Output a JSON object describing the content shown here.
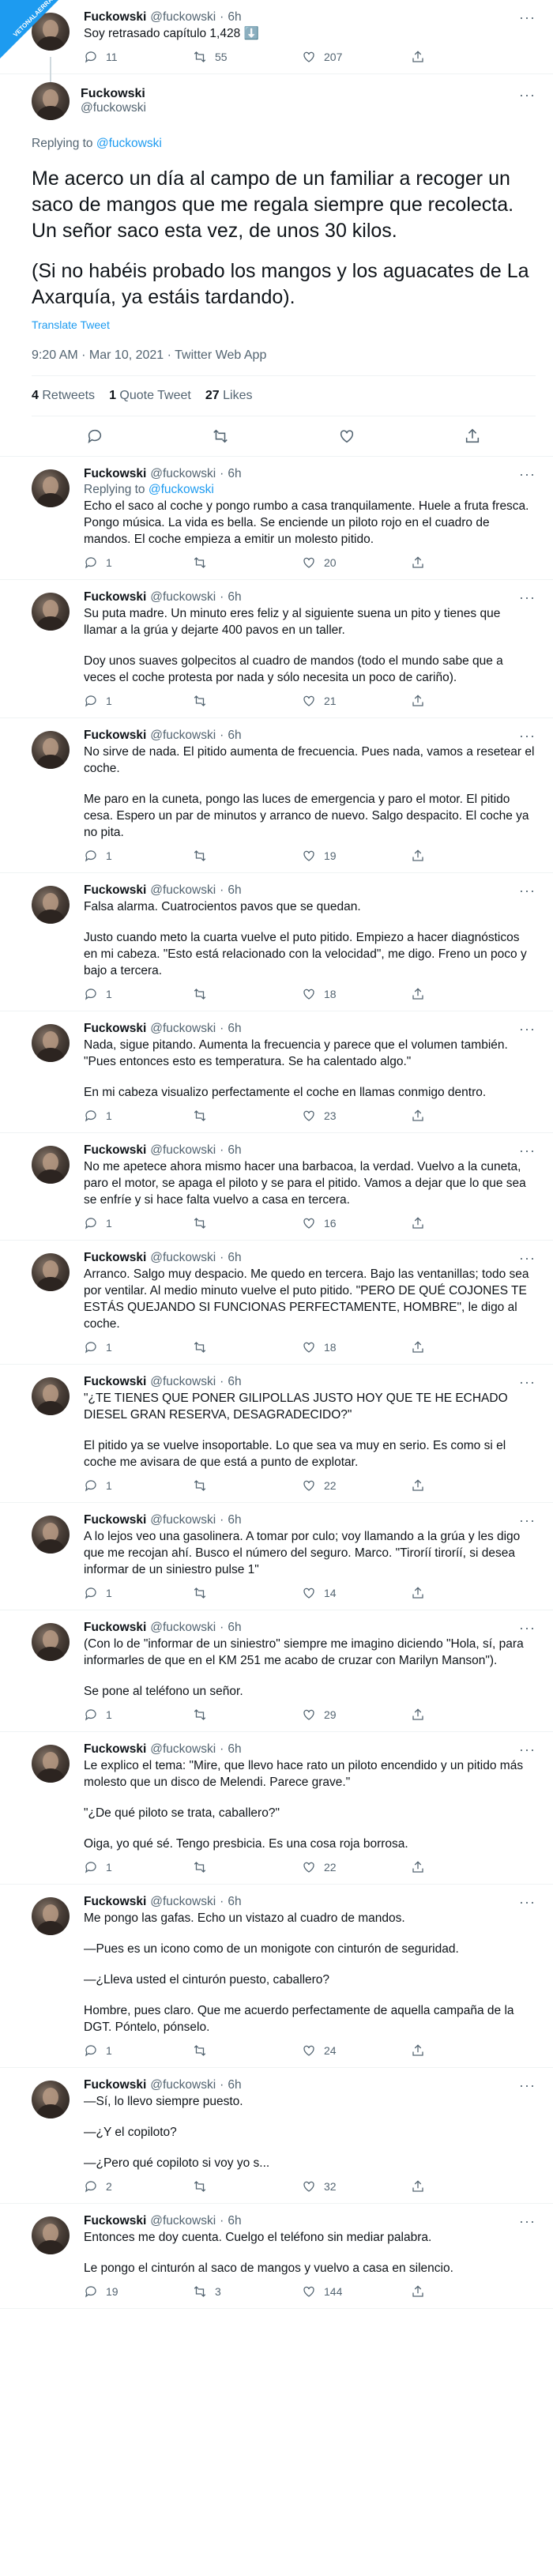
{
  "author": {
    "name": "Fuckowski",
    "handle": "@fuckowski",
    "time": "6h"
  },
  "top_tweet": {
    "text": "Soy retrasado capítulo 1,428 ⬇️",
    "replies": "11",
    "retweets": "55",
    "likes": "207"
  },
  "main_tweet": {
    "replying_label": "Replying to",
    "replying_handle": "@fuckowski",
    "paragraphs": [
      "Me acerco un día al campo de un familiar a recoger un saco de mangos que me regala siempre que recolecta. Un señor saco esta vez, de unos 30 kilos.",
      "(Si no habéis probado los mangos y los aguacates de La Axarquía, ya estáis tardando)."
    ],
    "translate": "Translate Tweet",
    "timestamp": "9:20 AM · Mar 10, 2021 · Twitter Web App",
    "retweets_count": "4",
    "retweets_label": "Retweets",
    "quotes_count": "1",
    "quotes_label": "Quote Tweet",
    "likes_count": "27",
    "likes_label": "Likes"
  },
  "replies": [
    {
      "replying": true,
      "paragraphs": [
        "Echo el saco al coche y pongo rumbo a casa tranquilamente. Huele a fruta fresca. Pongo música. La vida es bella. Se enciende un piloto rojo en el cuadro de mandos. El coche empieza a emitir un molesto pitido."
      ],
      "replies": "1",
      "retweets": "",
      "likes": "20"
    },
    {
      "replying": false,
      "paragraphs": [
        "Su puta madre. Un minuto eres feliz y al siguiente suena un pito y tienes que llamar a la grúa y dejarte 400 pavos en un taller.",
        "Doy unos suaves golpecitos al cuadro de mandos (todo el mundo sabe que a veces el coche protesta por nada y sólo necesita un poco de cariño)."
      ],
      "replies": "1",
      "retweets": "",
      "likes": "21"
    },
    {
      "replying": false,
      "paragraphs": [
        "No sirve de nada. El pitido aumenta de frecuencia. Pues nada, vamos a resetear el coche.",
        "Me paro en la cuneta, pongo las luces de emergencia y paro el motor. El pitido cesa. Espero un par de minutos y arranco de nuevo. Salgo despacito. El coche ya no pita."
      ],
      "replies": "1",
      "retweets": "",
      "likes": "19"
    },
    {
      "replying": false,
      "paragraphs": [
        "Falsa alarma. Cuatrocientos pavos que se quedan.",
        "Justo cuando meto la cuarta vuelve el puto pitido. Empiezo a hacer diagnósticos en mi cabeza. \"Esto está relacionado con la velocidad\", me digo. Freno un poco y bajo a tercera."
      ],
      "replies": "1",
      "retweets": "",
      "likes": "18"
    },
    {
      "replying": false,
      "paragraphs": [
        "Nada, sigue pitando. Aumenta la frecuencia y parece que el volumen también. \"Pues entonces esto es temperatura. Se ha calentado algo.\"",
        "En mi cabeza visualizo perfectamente el coche en llamas conmigo dentro."
      ],
      "replies": "1",
      "retweets": "",
      "likes": "23"
    },
    {
      "replying": false,
      "paragraphs": [
        "No me apetece ahora mismo hacer una barbacoa, la verdad. Vuelvo a la cuneta, paro el motor, se apaga el piloto y se para el pitido. Vamos a dejar que lo que sea se enfríe y si hace falta vuelvo a casa en tercera."
      ],
      "replies": "1",
      "retweets": "",
      "likes": "16"
    },
    {
      "replying": false,
      "paragraphs": [
        "Arranco. Salgo muy despacio. Me quedo en tercera. Bajo las ventanillas; todo sea por ventilar. Al medio minuto vuelve el puto pitido. \"PERO DE QUÉ COJONES TE ESTÁS QUEJANDO SI FUNCIONAS PERFECTAMENTE, HOMBRE\", le digo al coche."
      ],
      "replies": "1",
      "retweets": "",
      "likes": "18"
    },
    {
      "replying": false,
      "paragraphs": [
        "\"¿TE TIENES QUE PONER GILIPOLLAS JUSTO HOY QUE TE HE ECHADO DIESEL GRAN RESERVA, DESAGRADECIDO?\"",
        "El pitido ya se vuelve insoportable. Lo que sea va muy en serio. Es como si el coche me avisara de que está a punto de explotar."
      ],
      "replies": "1",
      "retweets": "",
      "likes": "22"
    },
    {
      "replying": false,
      "paragraphs": [
        "A lo lejos veo una gasolinera. A tomar por culo; voy llamando a la grúa y les digo que me recojan ahí. Busco el número del seguro. Marco. \"Tiroríí tiroríí, si desea informar de un siniestro pulse 1\""
      ],
      "replies": "1",
      "retweets": "",
      "likes": "14"
    },
    {
      "replying": false,
      "paragraphs": [
        "(Con lo de \"informar de un siniestro\" siempre me imagino diciendo \"Hola, sí, para informarles de que en el KM 251 me acabo de cruzar con Marilyn Manson\").",
        "Se pone al teléfono un señor."
      ],
      "replies": "1",
      "retweets": "",
      "likes": "29"
    },
    {
      "replying": false,
      "paragraphs": [
        "Le explico el tema: \"Mire, que llevo hace rato un piloto encendido y un pitido más molesto que un disco de Melendi. Parece grave.\"",
        "\"¿De qué piloto se trata, caballero?\"",
        "Oiga, yo qué sé. Tengo presbicia. Es una cosa roja borrosa."
      ],
      "replies": "1",
      "retweets": "",
      "likes": "22"
    },
    {
      "replying": false,
      "paragraphs": [
        "Me pongo las gafas. Echo un vistazo al cuadro de mandos.",
        "—Pues es un icono como de un monigote con cinturón de seguridad.",
        "—¿Lleva usted el cinturón puesto, caballero?",
        "Hombre, pues claro. Que me acuerdo perfectamente de aquella campaña de la DGT. Póntelo, pónselo."
      ],
      "replies": "1",
      "retweets": "",
      "likes": "24"
    },
    {
      "replying": false,
      "paragraphs": [
        "—Sí, lo llevo siempre puesto.",
        "—¿Y el copiloto?",
        "—¿Pero qué copiloto si voy yo s..."
      ],
      "replies": "2",
      "retweets": "",
      "likes": "32"
    },
    {
      "replying": false,
      "paragraphs": [
        "Entonces me doy cuenta. Cuelgo el teléfono sin mediar palabra.",
        "Le pongo el cinturón al saco de mangos y vuelvo a casa en silencio."
      ],
      "replies": "19",
      "retweets": "3",
      "likes": "144"
    }
  ],
  "watermark": {
    "text": "VETONALAERRA"
  }
}
